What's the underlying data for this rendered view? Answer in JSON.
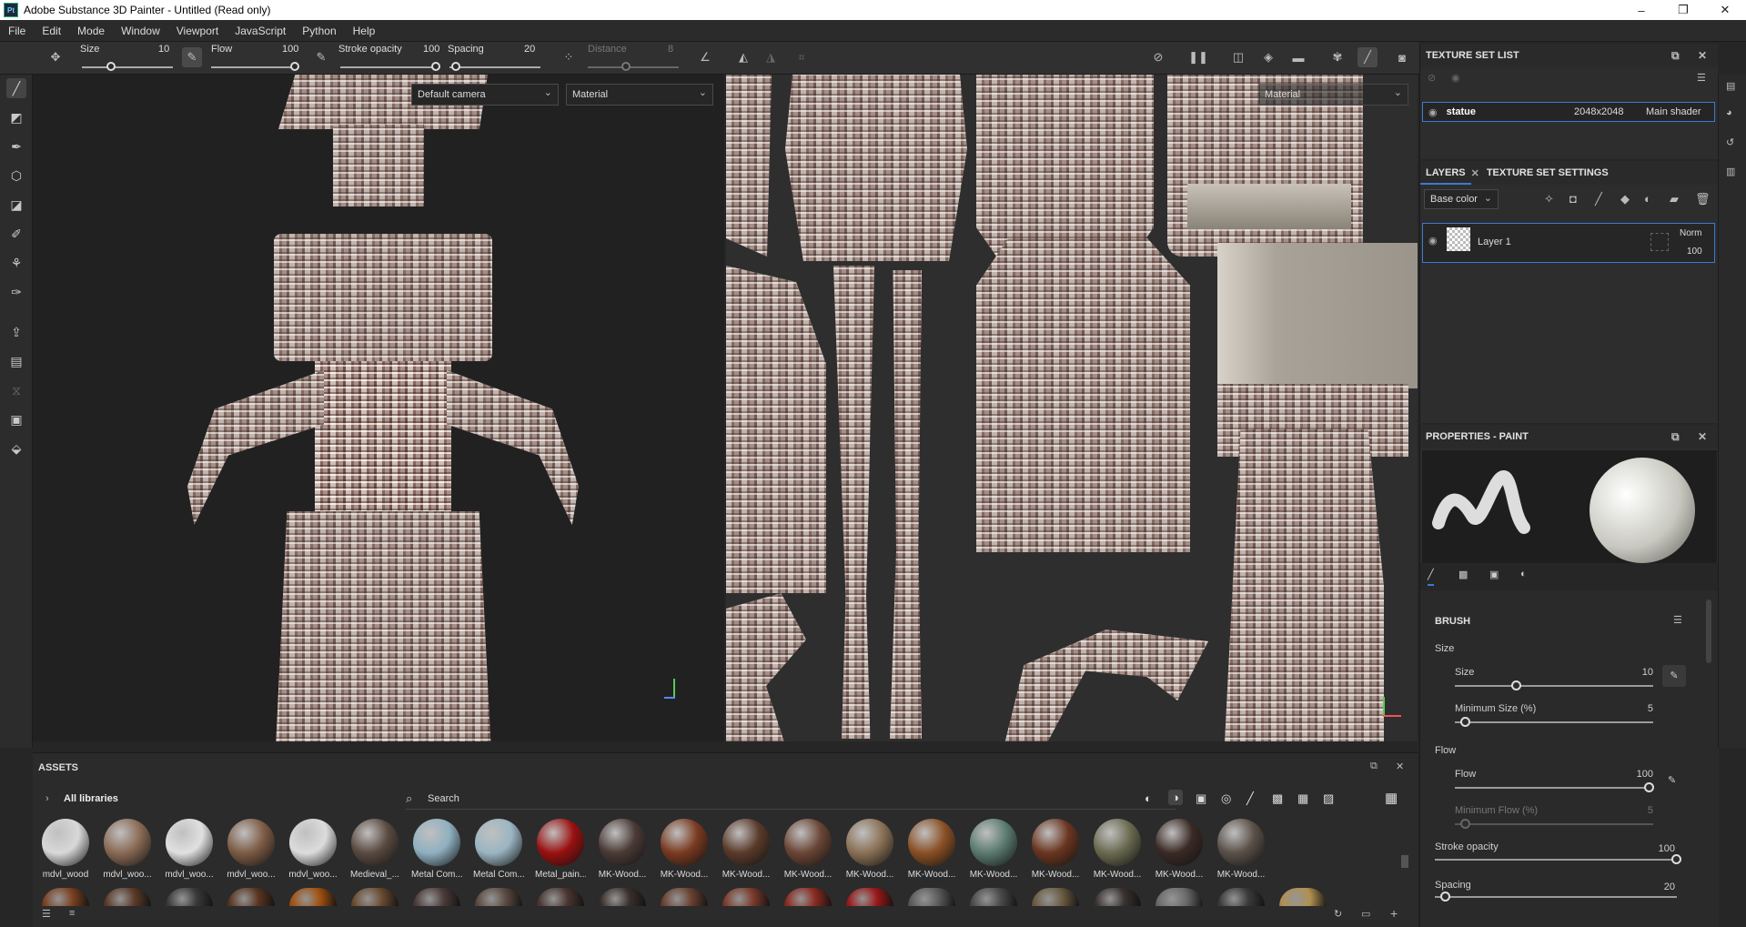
{
  "window": {
    "title": "Adobe Substance 3D Painter - Untitled (Read only)",
    "app_icon": "Pt"
  },
  "menu": [
    "File",
    "Edit",
    "Mode",
    "Window",
    "Viewport",
    "JavaScript",
    "Python",
    "Help"
  ],
  "toolbar": {
    "size_label": "Size",
    "size_value": "10",
    "flow_label": "Flow",
    "flow_value": "100",
    "stroke_opacity_label": "Stroke opacity",
    "stroke_opacity_value": "100",
    "spacing_label": "Spacing",
    "spacing_value": "20",
    "distance_label": "Distance",
    "distance_value": "8"
  },
  "viewport3d": {
    "camera": "Default camera",
    "mode": "Material"
  },
  "viewport2d": {
    "mode": "Material"
  },
  "texture_set_list": {
    "title": "TEXTURE SET LIST",
    "item": {
      "name": "statue",
      "resolution": "2048x2048",
      "shader": "Main shader"
    }
  },
  "layers": {
    "tab_layers": "LAYERS",
    "tab_settings": "TEXTURE SET SETTINGS",
    "channel": "Base color",
    "layer": {
      "name": "Layer 1",
      "blend": "Norm",
      "opacity": "100"
    }
  },
  "properties": {
    "title": "PROPERTIES - PAINT",
    "section": "BRUSH",
    "size_group": "Size",
    "size_label": "Size",
    "size_value": "10",
    "min_size_label": "Minimum Size (%)",
    "min_size_value": "5",
    "flow_group": "Flow",
    "flow_label": "Flow",
    "flow_value": "100",
    "min_flow_label": "Minimum Flow (%)",
    "min_flow_value": "5",
    "stroke_opacity_label": "Stroke opacity",
    "stroke_opacity_value": "100",
    "spacing_label": "Spacing",
    "spacing_value": "20"
  },
  "assets": {
    "title": "ASSETS",
    "library": "All libraries",
    "search_placeholder": "Search",
    "row1": [
      "mdvl_wood",
      "mdvl_woo...",
      "mdvl_woo...",
      "mdvl_woo...",
      "mdvl_woo...",
      "Medieval_...",
      "Metal Com...",
      "Metal Com...",
      "Metal_pain...",
      "MK-Wood...",
      "MK-Wood...",
      "MK-Wood...",
      "MK-Wood...",
      "MK-Wood...",
      "MK-Wood...",
      "MK-Wood...",
      "MK-Wood...",
      "MK-Wood...",
      "MK-Wood...",
      "MK-Wood..."
    ],
    "colors1": [
      "#d8d8d8",
      "#8a6a55",
      "#e0e0e0",
      "#7d5b44",
      "#dcdcdc",
      "#5a4a40",
      "#8fb0c0",
      "#9ab5c2",
      "#9a1010",
      "#4a3a35",
      "#7a3a20",
      "#5a3a2a",
      "#6a4535",
      "#8a7055",
      "#8a5025",
      "#5a7a70",
      "#6a3520",
      "#6a6a50",
      "#3a2a25",
      "#5a5048",
      "#4a2a18"
    ],
    "colors2": [
      "#7a4020",
      "#5a3a28",
      "#3a3a3a",
      "#5a3520",
      "#a05010",
      "#6a4a30",
      "#4a3a38",
      "#5a4a40",
      "#4a3530",
      "#3a2f2a",
      "#6a4030",
      "#7a3a2a",
      "#8a2a20",
      "#9a1818",
      "#5a5a5a",
      "#4a4a4a",
      "#6a5a40",
      "#3a3030",
      "#6a6a6a",
      "#3a3a3a",
      "#b09050"
    ]
  }
}
